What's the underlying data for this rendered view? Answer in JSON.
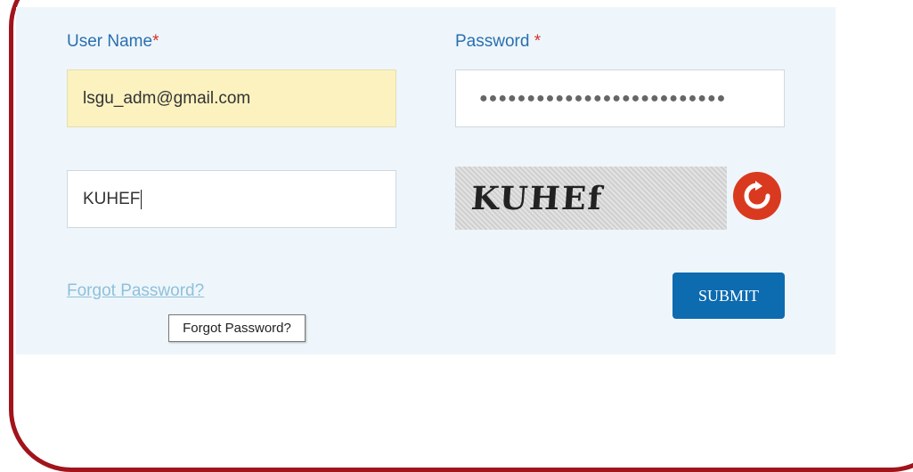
{
  "form": {
    "username_label": "User Name",
    "password_label": "Password ",
    "required_marker": "*",
    "username_value": "lsgu_adm@gmail.com",
    "password_mask": "●●●●●●●●●●●●●●●●●●●●●●●●●●",
    "captcha_input_value": "KUHEF",
    "captcha_text": "KUHEf",
    "forgot_link": "Forgot Password?",
    "forgot_tooltip": "Forgot Password?",
    "submit_label": "SUBMIT"
  },
  "colors": {
    "frame": "#a1141c",
    "panel_bg": "#eef6fb",
    "label": "#2a6fb0",
    "required": "#d9302c",
    "autofill_bg": "#fbf2c0",
    "submit_bg": "#0d6bb0",
    "refresh_bg": "#d93a1f"
  },
  "icons": {
    "refresh": "refresh-icon"
  }
}
